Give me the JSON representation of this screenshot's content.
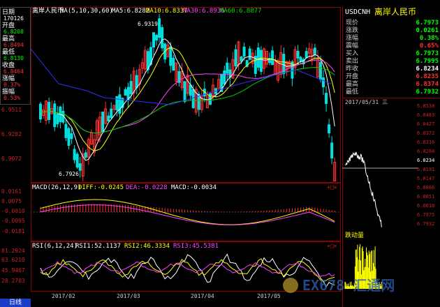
{
  "main_chart": {
    "title": "离岸人民币",
    "ma_params": "MA(5,10,30,60)",
    "ma5": "MA5:6.8282",
    "ma10": "MA10:6.8337",
    "ma30": "MA30:6.8936",
    "ma60": "MA60:6.8877",
    "high_marker": "6.9319",
    "low_marker": "6.7926",
    "y_ticks": [
      "6.9511",
      "6.9282",
      "6.9072"
    ],
    "colors": {
      "up": "#ff3030",
      "down": "#00e0e0",
      "ma5": "#ffffff",
      "ma10": "#ffff00",
      "ma30": "#ff40ff",
      "ma60": "#00d000",
      "extra": "#3030ff"
    }
  },
  "info_box": {
    "rows": [
      {
        "label": "日期",
        "value": "170126"
      },
      {
        "label": "开盘",
        "value": "6.8208"
      },
      {
        "label": "最高",
        "value": "6.8494"
      },
      {
        "label": "最低",
        "value": "6.8130"
      },
      {
        "label": "收盘",
        "value": "6.8464"
      },
      {
        "label": "涨幅",
        "value": "0.37%"
      },
      {
        "label": "振幅",
        "value": "0.53%"
      }
    ]
  },
  "macd_panel": {
    "title": "MACD(26,12,9)",
    "diff": "DIFF:-0.0245",
    "dea": "DEA:-0.0228",
    "macd": "MACD:-0.0034",
    "y_ticks": [
      "0.0161",
      "0.0075",
      "-0.0010",
      "-0.0095",
      "-0.0181"
    ]
  },
  "rsi_panel": {
    "title": "RSI(6,12,24)",
    "rsi1": "RSI1:52.1137",
    "rsi2": "RSI2:46.3334",
    "rsi3": "RSI3:45.5381",
    "y_ticks": [
      "81.2924",
      "63.6210",
      "45.9467",
      "28.2783"
    ]
  },
  "x_axis": [
    "2017/02",
    "2017/03",
    "2017/04",
    "2017/05"
  ],
  "bottom_tab": "日线",
  "quote_panel": {
    "symbol": "USDCNH",
    "name": "离岸人民币",
    "rows": [
      {
        "label": "现价",
        "value": "6.7973",
        "color": "#00ff00"
      },
      {
        "label": "涨跌",
        "value": "0.0261",
        "color": "#00ff00"
      },
      {
        "label": "涨幅",
        "value": "0.38%",
        "color": "#00ff00"
      },
      {
        "label": "震幅",
        "value": "0.65%",
        "color": "#ff3030"
      },
      {
        "label": "买入",
        "value": "6.7973",
        "color": "#00ff00"
      },
      {
        "label": "卖出",
        "value": "6.7995",
        "color": "#00ff00"
      },
      {
        "label": "昨收",
        "value": "6.8234",
        "color": "#ffffff"
      },
      {
        "label": "开盘",
        "value": "6.8235",
        "color": "#ff3030"
      },
      {
        "label": "最高",
        "value": "6.8374",
        "color": "#ff3030"
      },
      {
        "label": "最低",
        "value": "6.7932",
        "color": "#00ff00"
      }
    ]
  },
  "intraday": {
    "header": "2017/05/31 三",
    "y_ticks": [
      "6.8538",
      "6.8483",
      "6.8427",
      "6.8372",
      "6.8316",
      "6.8260",
      "6.8234",
      "6.8191",
      "6.8147",
      "6.8086",
      "6.8051",
      "6.8018",
      "6.7975",
      "6.7932"
    ],
    "volume_label": "跌动量"
  },
  "watermark": "EX678 汇通网"
}
